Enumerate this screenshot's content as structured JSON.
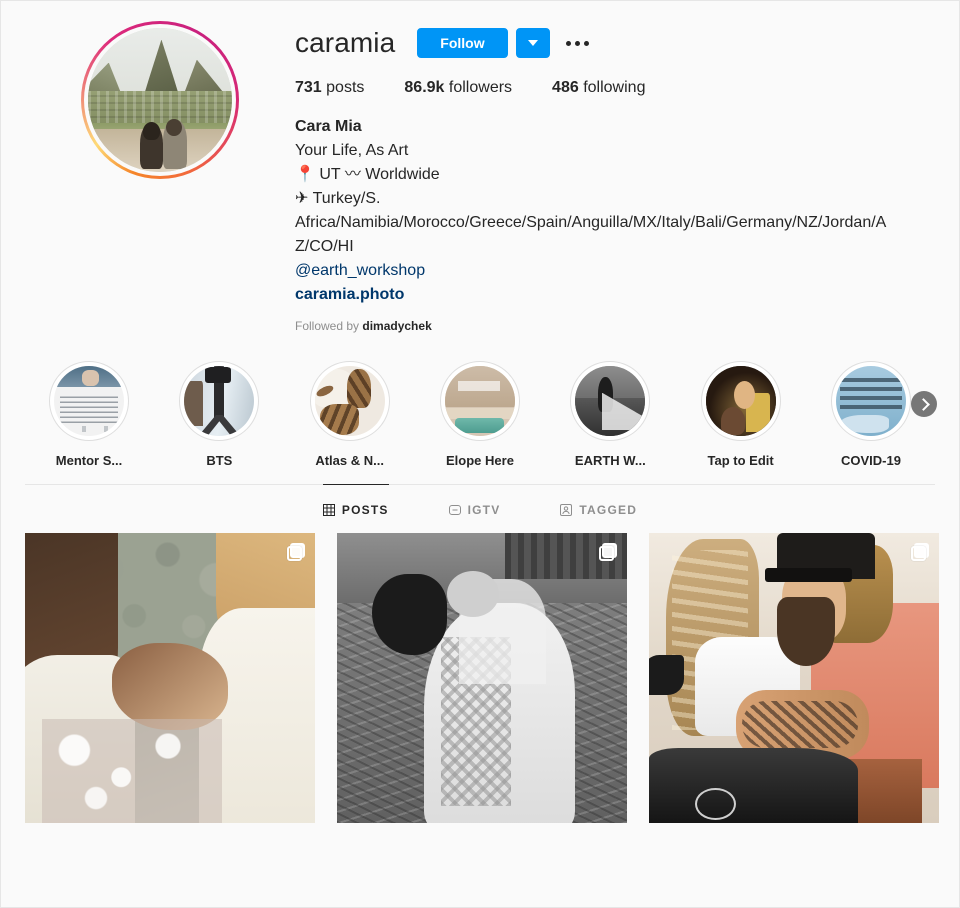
{
  "profile": {
    "username": "caramia",
    "follow_label": "Follow",
    "dropdown_icon": "chevron-down-icon",
    "more_icon": "more-options-icon",
    "avatar_alt": "profile-photo",
    "stats": [
      {
        "value": "731",
        "label": "posts"
      },
      {
        "value": "86.9k",
        "label": "followers"
      },
      {
        "value": "486",
        "label": "following"
      }
    ],
    "bio": {
      "full_name": "Cara Mia",
      "tagline": "Your Life, As Art",
      "location": "📍 UT 〰 Worldwide",
      "travel_prefix": "✈ Turkey/S.",
      "travel_list": "Africa/Namibia/Morocco/Greece/Spain/Anguilla/MX/Italy/Bali/Germany/NZ/Jordan/AZ/CO/HI",
      "mention": "@earth_workshop",
      "website": "caramia.photo"
    },
    "followed_by_prefix": "Followed by ",
    "followed_by_names": "dimadychek"
  },
  "highlights": [
    {
      "label": "Mentor S...",
      "thumb": "t-mentor"
    },
    {
      "label": "BTS",
      "thumb": "t-bts"
    },
    {
      "label": "Atlas & N...",
      "thumb": "t-atlas"
    },
    {
      "label": "Elope Here",
      "thumb": "t-elope"
    },
    {
      "label": "EARTH W...",
      "thumb": "t-earth"
    },
    {
      "label": "Tap to Edit",
      "thumb": "t-tap"
    },
    {
      "label": "COVID-19",
      "thumb": "t-covid"
    }
  ],
  "highlights_next_icon": "chevron-right-icon",
  "tabs": [
    {
      "label": "POSTS",
      "icon": "grid-icon",
      "active": true
    },
    {
      "label": "IGTV",
      "icon": "igtv-icon",
      "active": false
    },
    {
      "label": "TAGGED",
      "icon": "tagged-person-icon",
      "active": false
    }
  ],
  "posts": [
    {
      "alt": "two-brides-holding-hands",
      "thumb": "p1",
      "multi": true
    },
    {
      "alt": "black-and-white-brides-in-field",
      "thumb": "p2",
      "multi": true
    },
    {
      "alt": "couple-on-motorcycle",
      "thumb": "p3",
      "multi": true
    }
  ],
  "colors": {
    "accent_blue": "#0095f6",
    "link_blue": "#00376b",
    "text_primary": "#262626",
    "text_secondary": "#8e8e8e",
    "page_background": "#fafafa",
    "border": "#e6e6e6"
  }
}
